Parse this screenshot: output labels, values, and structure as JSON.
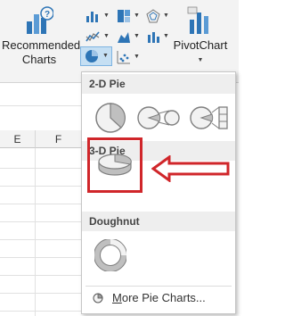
{
  "ribbon": {
    "recommended_charts_line1": "Recommended",
    "recommended_charts_line2": "Charts",
    "pivot_chart_label": "PivotChart"
  },
  "sheet": {
    "column_headers": [
      "E",
      "F"
    ]
  },
  "pie_menu": {
    "sections": [
      {
        "title": "2-D Pie"
      },
      {
        "title": "3-D Pie"
      },
      {
        "title": "Doughnut"
      }
    ],
    "more_link_prefix": "M",
    "more_link_rest": "ore Pie Charts..."
  },
  "colors": {
    "highlight": "#d0262a",
    "selected": "#c5dff3",
    "accent": "#2e75b6"
  },
  "icons": [
    "recommended-charts-icon",
    "pivot-chart-icon",
    "pie-2d-icon",
    "pie-of-pie-icon",
    "bar-of-pie-icon",
    "pie-3d-icon",
    "doughnut-icon",
    "pie-chart-small-icon",
    "red-arrow"
  ]
}
